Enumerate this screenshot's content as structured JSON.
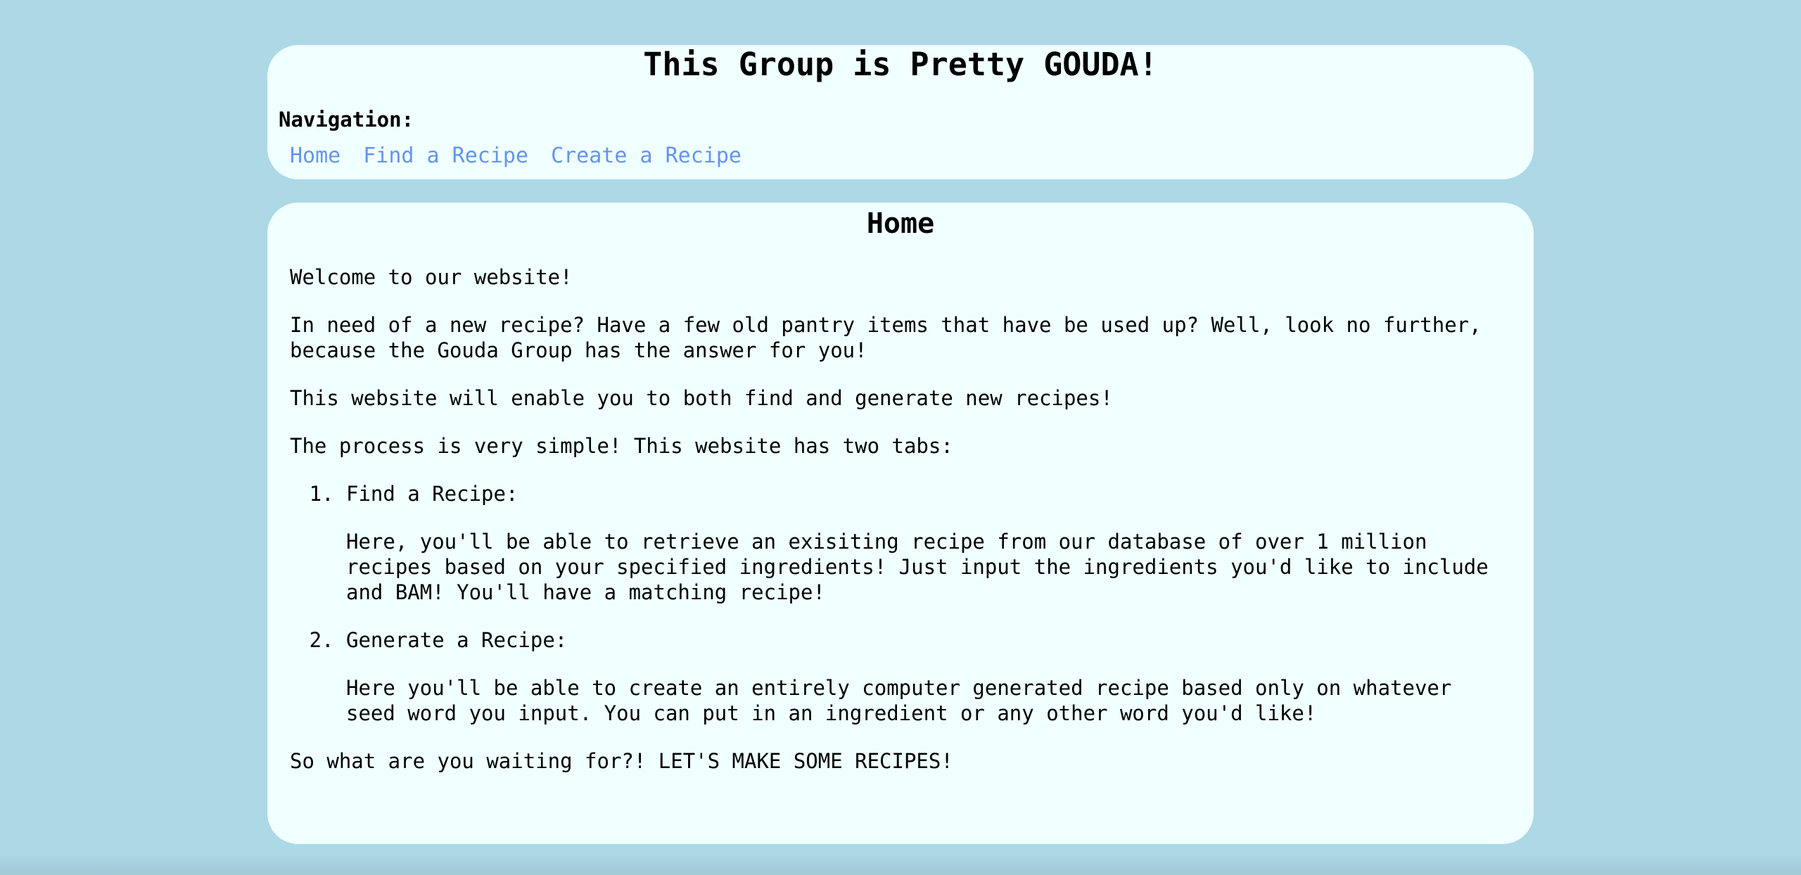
{
  "header": {
    "title": "This Group is Pretty GOUDA!",
    "nav_label": "Navigation:",
    "nav_links": [
      "Home",
      "Find a Recipe",
      "Create a Recipe"
    ]
  },
  "main": {
    "page_title": "Home",
    "paragraphs": [
      "Welcome to our website!",
      "In need of a new recipe? Have a few old pantry items that have be used up? Well, look no further, because the Gouda Group has the answer for you!",
      "This website will enable you to both find and generate new recipes!",
      "The process is very simple! This website has two tabs:"
    ],
    "steps": [
      {
        "title": "Find a Recipe:",
        "description": "Here, you'll be able to retrieve an exisiting recipe from our database of over 1 million recipes based on your specified ingredients! Just input the ingredients you'd like to include and BAM! You'll have a matching recipe!"
      },
      {
        "title": "Generate a Recipe:",
        "description": "Here you'll be able to create an entirely computer generated recipe based only on whatever seed word you input. You can put in an ingredient or any other word you'd like!"
      }
    ],
    "closing": "So what are you waiting for?! LET'S MAKE SOME RECIPES!"
  },
  "colors": {
    "background": "#add8e6",
    "card": "#f0ffff",
    "link": "#6495ed"
  }
}
